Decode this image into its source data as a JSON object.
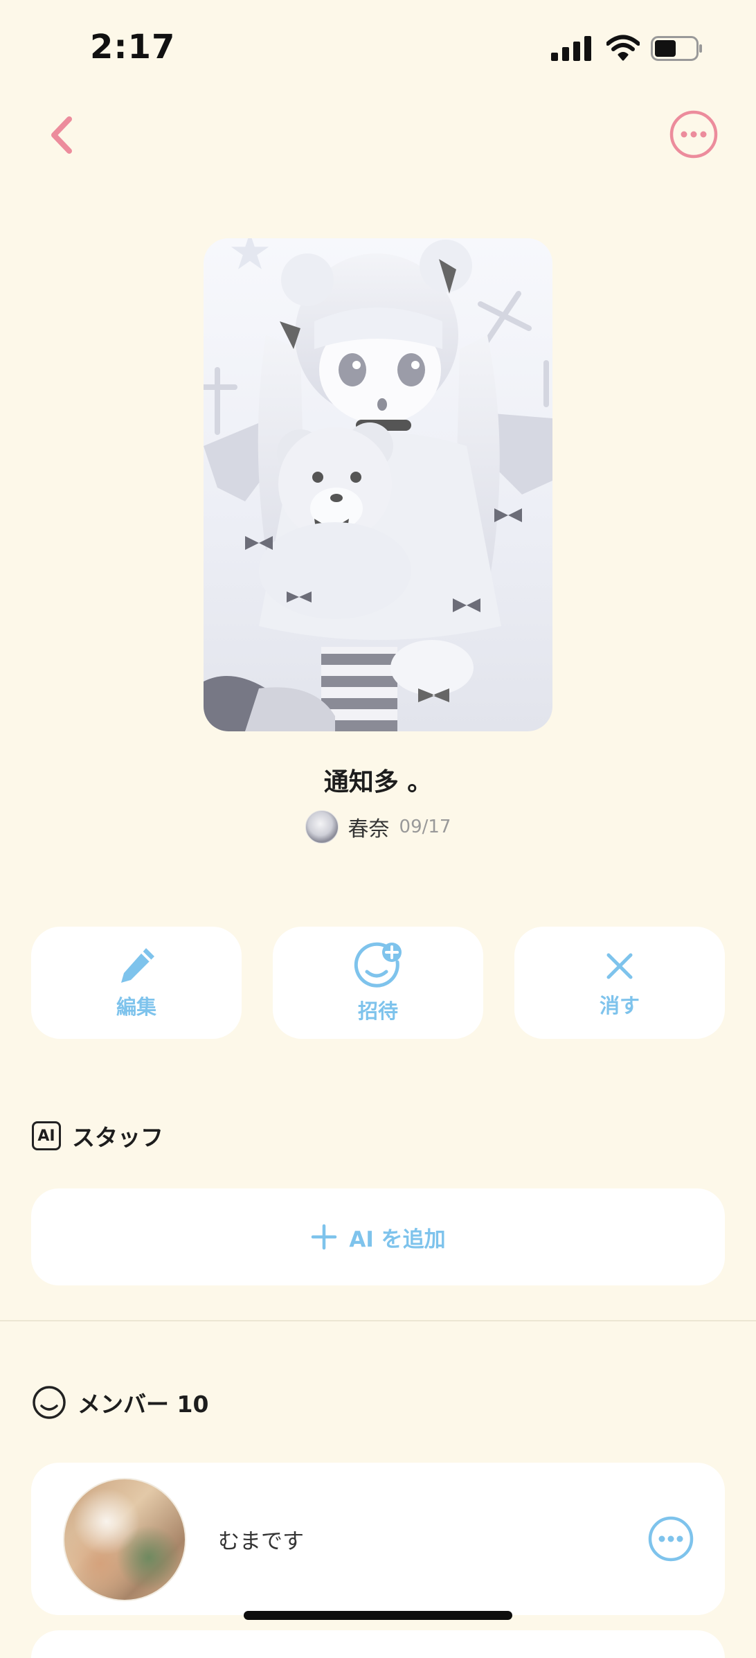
{
  "status_bar": {
    "time": "2:17"
  },
  "nav": {
    "back_icon": "chevron-left-icon",
    "more_icon": "more-horizontal-icon",
    "accent": "#EC8C9C"
  },
  "group": {
    "title": "通知多 。",
    "owner_name": "春奈",
    "date": "09/17"
  },
  "actions": [
    {
      "label": "編集",
      "icon": "pencil-icon"
    },
    {
      "label": "招待",
      "icon": "smile-plus-icon"
    },
    {
      "label": "消す",
      "icon": "close-icon"
    }
  ],
  "ai_section": {
    "heading": "スタッフ",
    "badge": "AI",
    "add_label": "AI を追加"
  },
  "member_section": {
    "heading": "メンバー 10",
    "members": [
      {
        "name": "むまです"
      }
    ]
  },
  "colors": {
    "background": "#FDF8E9",
    "accent_blue": "#7EC3EC",
    "accent_pink": "#EC8C9C",
    "card": "#FFFFFF"
  }
}
